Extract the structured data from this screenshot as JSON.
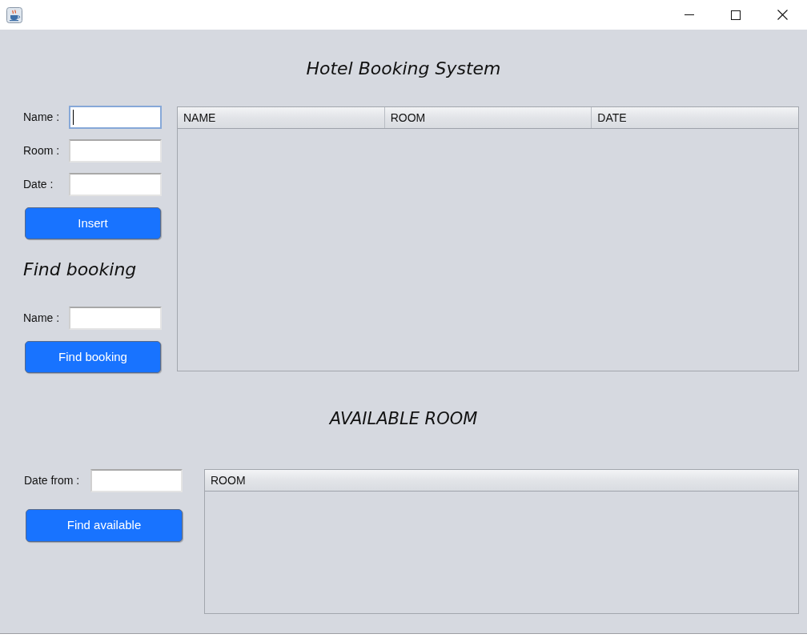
{
  "title": "Hotel Booking System",
  "booking_form": {
    "fields": [
      {
        "label": "Name :",
        "focused": true
      },
      {
        "label": "Room :",
        "focused": false
      },
      {
        "label": "Date :",
        "focused": false
      }
    ],
    "button": "Insert"
  },
  "find_booking": {
    "heading": "Find booking",
    "fields": [
      {
        "label": "Name :",
        "focused": false
      }
    ],
    "button": "Find booking"
  },
  "bookings_table": {
    "columns": [
      "NAME",
      "ROOM",
      "DATE"
    ]
  },
  "available_room": {
    "heading": "AVAILABLE ROOM",
    "fields": [
      {
        "label": "Date from :",
        "focused": false
      }
    ],
    "button": "Find available"
  },
  "rooms_table": {
    "columns": [
      "ROOM"
    ]
  }
}
